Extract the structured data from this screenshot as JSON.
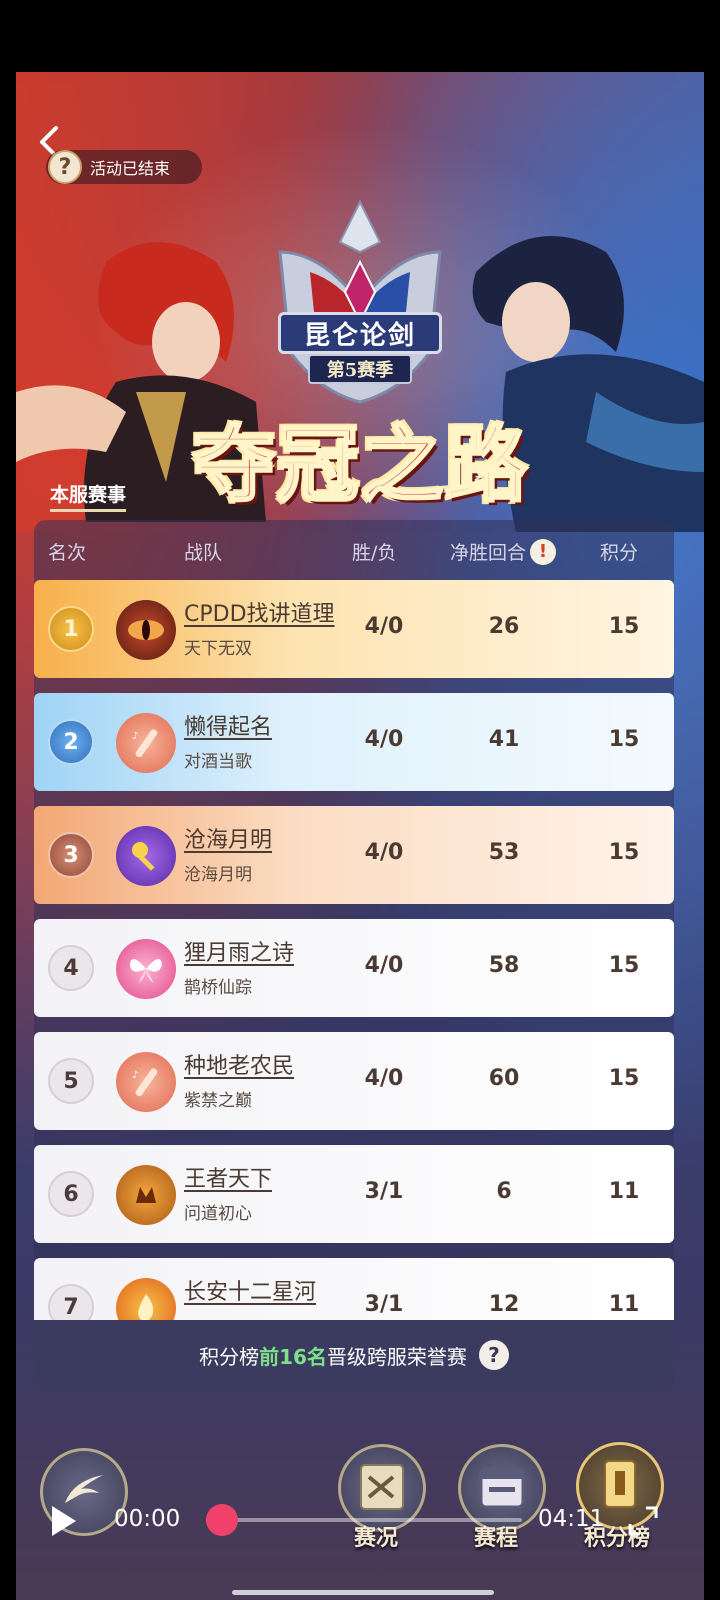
{
  "header": {
    "event_status": "活动已结束",
    "emblem_title": "昆仑论剑",
    "emblem_season": "第5赛季",
    "main_title": "夺冠之路",
    "server_tab": "本服赛事"
  },
  "table": {
    "columns": [
      "名次",
      "战队",
      "胜/负",
      "净胜回合",
      "积分"
    ],
    "net_rounds_info_icon": "!",
    "rows": [
      {
        "rank": "1",
        "team": "CPDD找讲道理",
        "server": "天下无双",
        "wl": "4/0",
        "net": "26",
        "pts": "15",
        "icon": "dragon-eye-icon"
      },
      {
        "rank": "2",
        "team": "懒得起名",
        "server": "对酒当歌",
        "wl": "4/0",
        "net": "41",
        "pts": "15",
        "icon": "flute-icon"
      },
      {
        "rank": "3",
        "team": "沧海月明",
        "server": "沧海月明",
        "wl": "4/0",
        "net": "53",
        "pts": "15",
        "icon": "key-icon"
      },
      {
        "rank": "4",
        "team": "狸月雨之诗",
        "server": "鹊桥仙踪",
        "wl": "4/0",
        "net": "58",
        "pts": "15",
        "icon": "butterfly-icon"
      },
      {
        "rank": "5",
        "team": "种地老农民",
        "server": "紫禁之巅",
        "wl": "4/0",
        "net": "60",
        "pts": "15",
        "icon": "flute-icon"
      },
      {
        "rank": "6",
        "team": "王者天下",
        "server": "问道初心",
        "wl": "3/1",
        "net": "6",
        "pts": "11",
        "icon": "crown-seal-icon"
      },
      {
        "rank": "7",
        "team": "长安十二星河",
        "server": "",
        "wl": "3/1",
        "net": "12",
        "pts": "11",
        "icon": "flame-icon"
      }
    ]
  },
  "footer": {
    "text_before": "积分榜",
    "highlight": "前16名",
    "text_after": "晋级跨服荣誉赛",
    "help": "?"
  },
  "nav": {
    "matches_label": "赛况",
    "schedule_label": "赛程",
    "standings_label": "积分榜"
  },
  "video": {
    "current_time": "00:00",
    "duration": "04:11",
    "progress": 0.0
  },
  "colors": {
    "gold_row": "#fde3b0",
    "silver_row": "#dff1fc",
    "bronze_row": "#fbdcc2",
    "highlight_green": "#7ee08a",
    "progress_knob": "#f1416a"
  }
}
